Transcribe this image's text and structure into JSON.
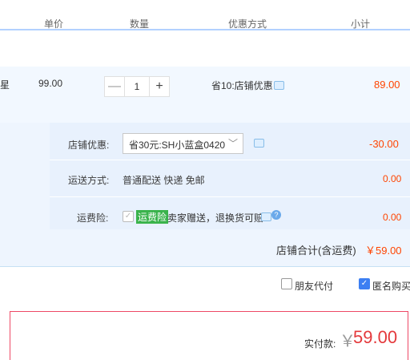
{
  "header": {
    "price": "单价",
    "qty": "数量",
    "discount_method": "优惠方式",
    "subtotal": "小计"
  },
  "item": {
    "title_tail": "星",
    "price": "99.00",
    "qty": "1",
    "minus": "—",
    "plus": "+",
    "promo": "省10:店铺优惠",
    "subtotal": "89.00"
  },
  "shop_discount": {
    "label": "店铺优惠:",
    "selected": "省30元:SH小蓝盒0420",
    "value": "-30.00"
  },
  "shipping": {
    "label": "运送方式:",
    "method": "普通配送 快递 免邮",
    "value": "0.00"
  },
  "insurance": {
    "label": "运费险:",
    "tag": "运费险",
    "desc": "卖家赠送，退换货可赔",
    "value": "0.00"
  },
  "shop_total": {
    "label": "店铺合计(含运费)",
    "value": "￥59.00"
  },
  "options": {
    "friend_pay": "朋友代付",
    "anonymous": "匿名购买"
  },
  "pay": {
    "label": "实付款:",
    "currency": "￥",
    "amount": "59.00"
  },
  "colors": {
    "accent": "#3d7ff2",
    "price": "#e4393c"
  }
}
